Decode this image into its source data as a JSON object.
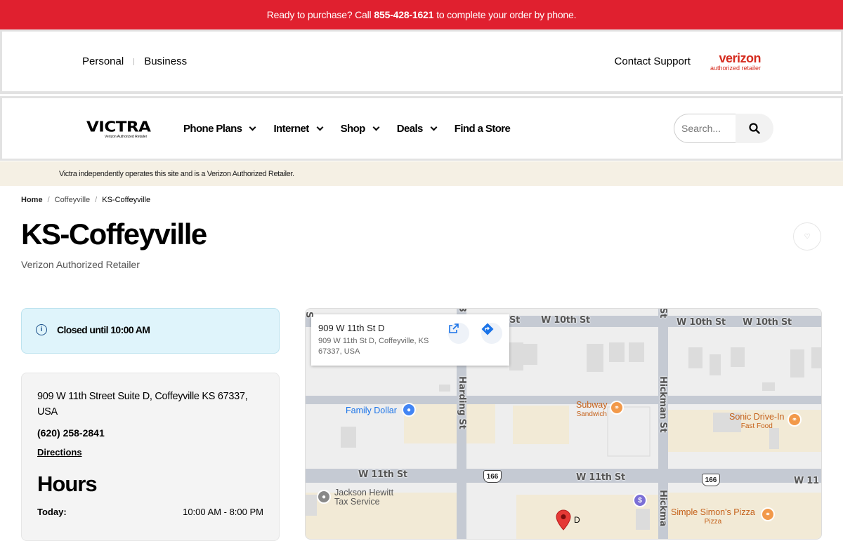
{
  "promo": {
    "prefix": "Ready to purchase? Call",
    "phone": "855-428-1621",
    "suffix": "to complete your order by phone."
  },
  "topbar": {
    "personal": "Personal",
    "business": "Business",
    "contact": "Contact Support",
    "logo": {
      "big": "verizon",
      "small": "authorized retailer"
    }
  },
  "nav": {
    "brand": {
      "name": "VICTRA",
      "sub": "Verizon Authorized Retailer"
    },
    "items": [
      {
        "label": "Phone Plans",
        "has_dropdown": true
      },
      {
        "label": "Internet",
        "has_dropdown": true
      },
      {
        "label": "Shop",
        "has_dropdown": true
      },
      {
        "label": "Deals",
        "has_dropdown": true
      },
      {
        "label": "Find a Store",
        "has_dropdown": false
      }
    ],
    "search_placeholder": "Search..."
  },
  "disclaimer": "Victra independently operates this site and is a Verizon Authorized Retailer.",
  "breadcrumb": {
    "home": "Home",
    "city": "Coffeyville",
    "current": "KS-Coffeyville"
  },
  "page": {
    "title": "KS-Coffeyville",
    "subtitle": "Verizon Authorized Retailer"
  },
  "status": {
    "text": "Closed until 10:00 AM",
    "color": "#dff4fb"
  },
  "store": {
    "address": "909 W 11th Street Suite D, Coffeyville KS 67337, USA",
    "phone": "(620) 258-2841",
    "directions": "Directions",
    "hours_title": "Hours",
    "hours": [
      {
        "day": "Today:",
        "time": "10:00 AM - 8:00 PM"
      }
    ]
  },
  "map": {
    "card": {
      "title": "909 W 11th St D",
      "address": "909 W 11th St D, Coffeyville, KS 67337, USA"
    },
    "streets": {
      "w10_a": "W 10th St",
      "w10_b": "W 10th St",
      "w10_c": "W 10th St",
      "w10_d": "St",
      "w11_a": "W 11th St",
      "w11_b": "W 11th St",
      "w11_c": "W 11",
      "harding": "Harding St",
      "hickman": "Hickman St",
      "hickman2": "Hickma",
      "st": "St",
      "s": "S",
      "three": "3"
    },
    "routes": [
      "166",
      "166",
      "166"
    ],
    "pois": {
      "family_dollar": "Family Dollar",
      "subway": "Subway",
      "subway_sub": "Sandwich",
      "sonic": "Sonic Drive-In",
      "sonic_sub": "Fast Food",
      "jackson": "Jackson Hewitt",
      "jackson2": "Tax Service",
      "simon": "Simple Simon's Pizza",
      "simon_sub": "Pizza",
      "marker": "D"
    },
    "accent_colors": {
      "food": "#f2994a",
      "shop": "#4285f4",
      "service": "#888888",
      "pin": "#e53935",
      "money": "#7b6fd6"
    }
  }
}
